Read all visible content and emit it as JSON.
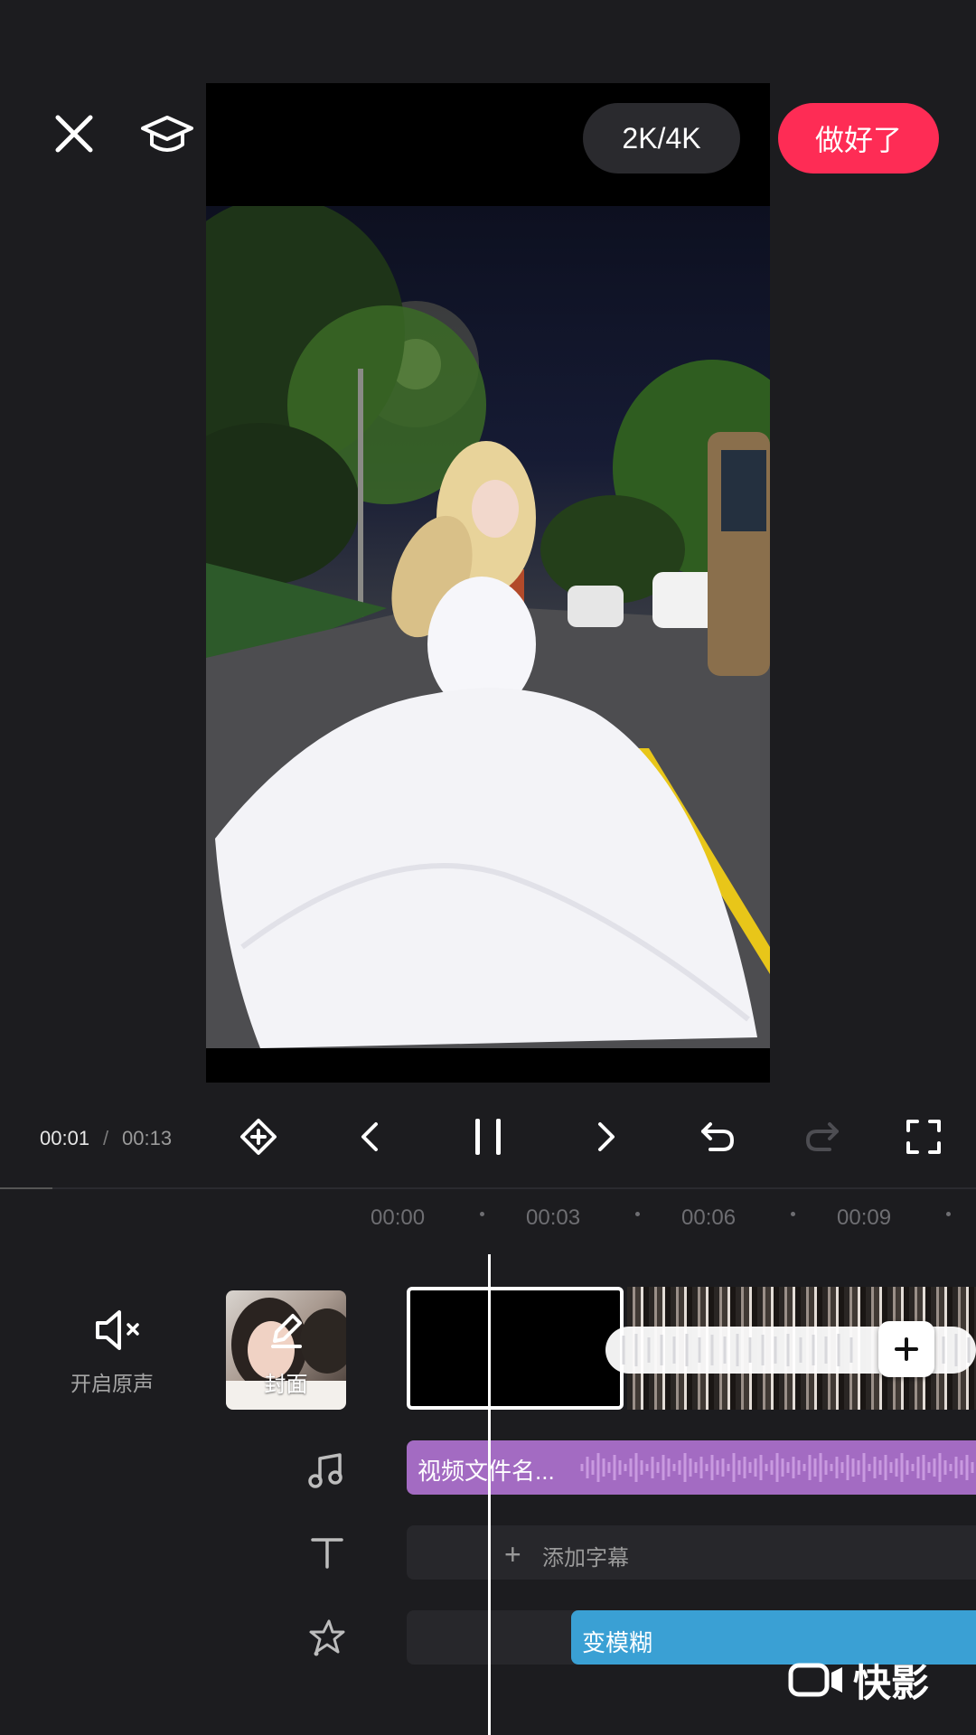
{
  "top_bar": {
    "resolution_label": "2K/4K",
    "done_label": "做好了"
  },
  "playback": {
    "current_time": "00:01",
    "separator": "/",
    "total_time": "00:13"
  },
  "ruler": {
    "ticks": [
      "00:00",
      "00:03",
      "00:06",
      "00:09"
    ]
  },
  "tracks": {
    "mute_label": "开启原声",
    "cover_label": "封面",
    "audio_label": "视频文件名...",
    "subtitle_label": "添加字幕",
    "effect_label": "变模糊"
  },
  "watermark": {
    "text": "快影"
  },
  "colors": {
    "background": "#1c1c1f",
    "accent": "#fe2c55",
    "audio_track": "#a36bc2",
    "effect_track": "#3aa0d4"
  },
  "icons": [
    "close-icon",
    "graduation-cap-icon",
    "keyframe-icon",
    "prev-frame-icon",
    "pause-icon",
    "next-frame-icon",
    "undo-icon",
    "redo-icon",
    "fullscreen-icon",
    "mute-icon",
    "edit-icon",
    "plus-icon",
    "music-icon",
    "text-icon",
    "effect-icon",
    "kuaiying-logo-icon"
  ]
}
